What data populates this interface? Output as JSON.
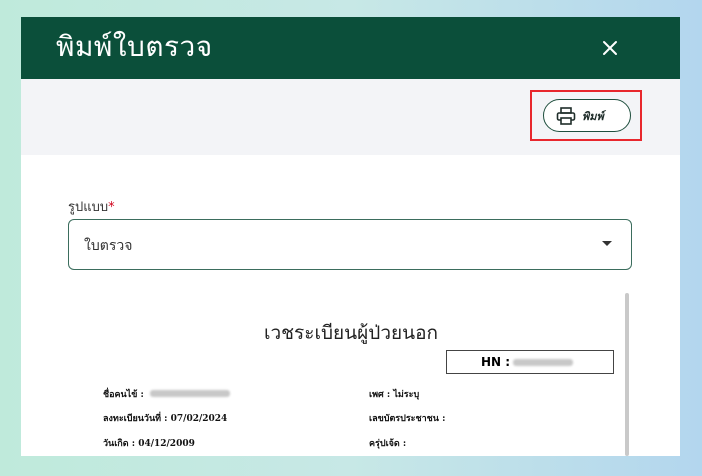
{
  "dialog": {
    "title": "พิมพ์ใบตรวจ",
    "close_icon": "close-icon"
  },
  "toolbar": {
    "print_label": "พิมพ์",
    "print_icon": "printer-icon"
  },
  "form": {
    "format_label": "รูปแบบ",
    "required_mark": "*",
    "selected_format": "ใบตรวจ"
  },
  "preview": {
    "document_title": "เวชระเบียนผู้ป่วยนอก",
    "hn_label": "HN :",
    "fields": {
      "name_label": "ชื่อคนไข้ :",
      "gender_label": "เพศ :",
      "gender_value": "ไม่ระบุ",
      "register_date_label": "ลงทะเบียนวันที่ :",
      "register_date_value": "07/02/2024",
      "citizen_id_label": "เลขบัตรประชาชน :",
      "birthdate_label": "วันเกิด :",
      "birthdate_value": "04/12/2009",
      "allergy_label": "ครุ่ปเจ้ด :"
    }
  },
  "colors": {
    "header_bg": "#0b4f3a",
    "highlight_border": "#e8272d",
    "required": "#d0021b"
  }
}
